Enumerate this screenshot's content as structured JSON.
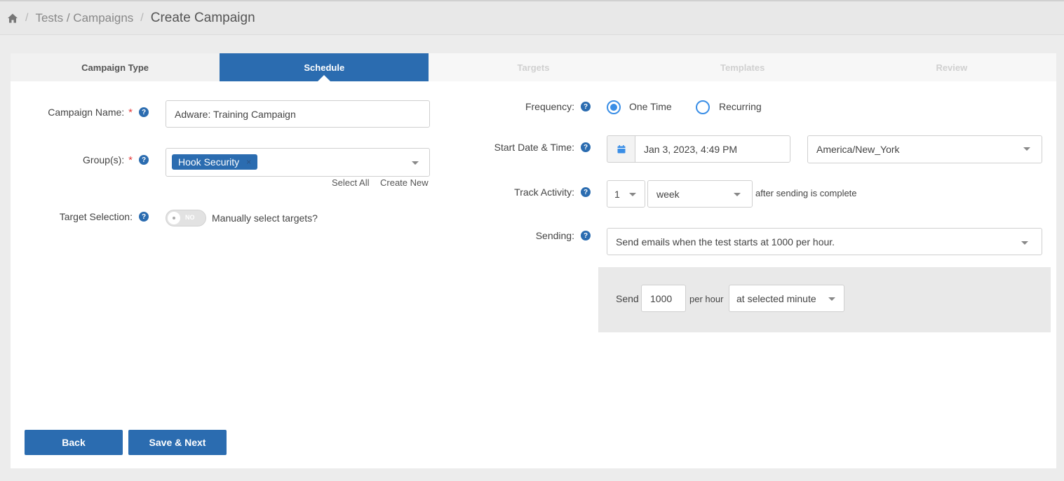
{
  "breadcrumb": {
    "link": "Tests / Campaigns",
    "current": "Create Campaign"
  },
  "steps": [
    "Campaign Type",
    "Schedule",
    "Targets",
    "Templates",
    "Review"
  ],
  "left": {
    "campaign_name_label": "Campaign Name:",
    "campaign_name_value": "Adware: Training Campaign",
    "groups_label": "Group(s):",
    "group_chip": "Hook Security",
    "select_all": "Select All",
    "create_new": "Create New",
    "target_selection_label": "Target Selection:",
    "toggle_text": "NO",
    "toggle_desc": "Manually select targets?"
  },
  "right": {
    "frequency_label": "Frequency:",
    "freq_one_time": "One Time",
    "freq_recurring": "Recurring",
    "start_label": "Start Date & Time:",
    "start_value": "Jan 3, 2023, 4:49 PM",
    "timezone": "America/New_York",
    "track_label": "Track Activity:",
    "track_num": "1",
    "track_unit": "week",
    "track_suffix": "after sending is complete",
    "sending_label": "Sending:",
    "sending_value": "Send emails when the test starts at 1000 per hour.",
    "send_word": "Send",
    "send_rate": "1000",
    "per_hour": "per hour",
    "minute_option": "at selected minute"
  },
  "buttons": {
    "back": "Back",
    "save_next": "Save & Next"
  },
  "required_mark": "*",
  "help_glyph": "?",
  "chip_remove": "×",
  "colors": {
    "primary": "#2b6cb0",
    "radio": "#3a8ee6",
    "required": "#e53e3e"
  }
}
